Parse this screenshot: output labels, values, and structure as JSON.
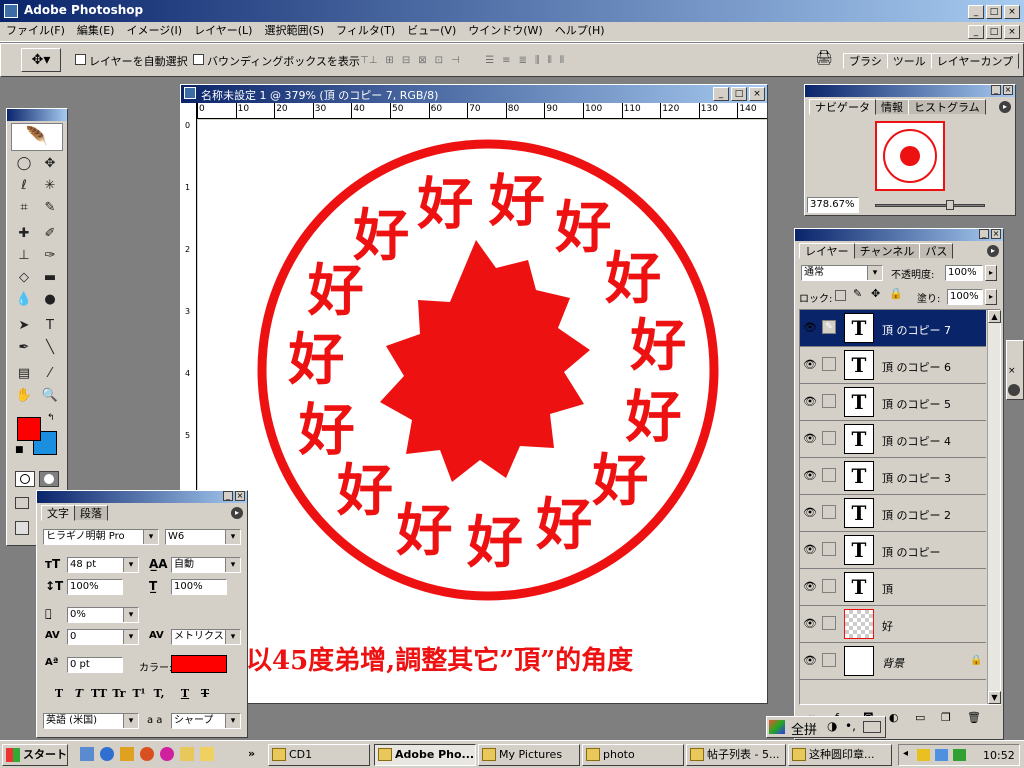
{
  "app": {
    "title": "Adobe Photoshop"
  },
  "menu": [
    "ファイル(F)",
    "編集(E)",
    "イメージ(I)",
    "レイヤー(L)",
    "選択範囲(S)",
    "フィルタ(T)",
    "ビュー(V)",
    "ウインドウ(W)",
    "ヘルプ(H)"
  ],
  "options": {
    "auto_select": "レイヤーを自動選択",
    "bounding_box": "バウンディングボックスを表示",
    "well_tabs": [
      "ブラシ",
      "ツール",
      "レイヤーカンプ"
    ]
  },
  "document": {
    "title": "名称未設定 1 @ 379% (頂 のコピー 7, RGB/8)",
    "ruler_ticks": [
      "0",
      "10",
      "20",
      "30",
      "40",
      "50",
      "60",
      "70",
      "80",
      "90",
      "100",
      "110",
      "120",
      "130",
      "140"
    ],
    "seal_chars": [
      "好",
      "好",
      "好",
      "好",
      "好",
      "好",
      "好",
      "好",
      "好",
      "好",
      "好",
      "好",
      "好",
      "好",
      "好"
    ],
    "caption": "以45度弟增,調整其它”頂”的角度"
  },
  "navigator": {
    "tabs": [
      "ナビゲータ",
      "情報",
      "ヒストグラム"
    ],
    "zoom": "378.67%"
  },
  "character": {
    "tabs": [
      "文字",
      "段落"
    ],
    "font": "ヒラギノ明朝 Pro",
    "weight": "W6",
    "size": "48 pt",
    "leading": "自動",
    "vscale": "100%",
    "hscale": "100%",
    "baseline_pct": "0%",
    "kerning": "0",
    "tracking_mode": "メトリクス",
    "baseline_shift": "0 pt",
    "color_label": "カラー:",
    "color": "#ff0000",
    "style_btns": [
      "T",
      "T",
      "TT",
      "Tr",
      "T¹",
      "T,",
      "T",
      "T"
    ],
    "language": "英語 (米国)",
    "aa_label": "a a",
    "antialias": "シャープ"
  },
  "layers": {
    "tabs": [
      "レイヤー",
      "チャンネル",
      "パス"
    ],
    "blend": "通常",
    "opacity_label": "不透明度:",
    "opacity": "100%",
    "lock_label": "ロック:",
    "fill_label": "塗り:",
    "fill": "100%",
    "items": [
      {
        "name": "頂 のコピー 7",
        "thumb": "T",
        "selected": true
      },
      {
        "name": "頂 のコピー 6",
        "thumb": "T"
      },
      {
        "name": "頂 のコピー 5",
        "thumb": "T"
      },
      {
        "name": "頂 のコピー 4",
        "thumb": "T"
      },
      {
        "name": "頂 のコピー 3",
        "thumb": "T"
      },
      {
        "name": "頂 のコピー 2",
        "thumb": "T"
      },
      {
        "name": "頂 のコピー",
        "thumb": "T"
      },
      {
        "name": "頂",
        "thumb": "T"
      },
      {
        "name": "好",
        "thumb": ""
      },
      {
        "name": "背景",
        "thumb": ""
      }
    ]
  },
  "ime": {
    "mode": "全拼"
  },
  "taskbar": {
    "start": "スタート",
    "buttons": [
      "CD1",
      "Adobe Pho...",
      "My Pictures",
      "photo",
      "帖子列表 - 5...",
      "这种圆印章..."
    ],
    "clock": "10:52"
  },
  "colors": {
    "foreground": "#ff0000",
    "background": "#1a8fe0",
    "seal": "#ee1111"
  }
}
